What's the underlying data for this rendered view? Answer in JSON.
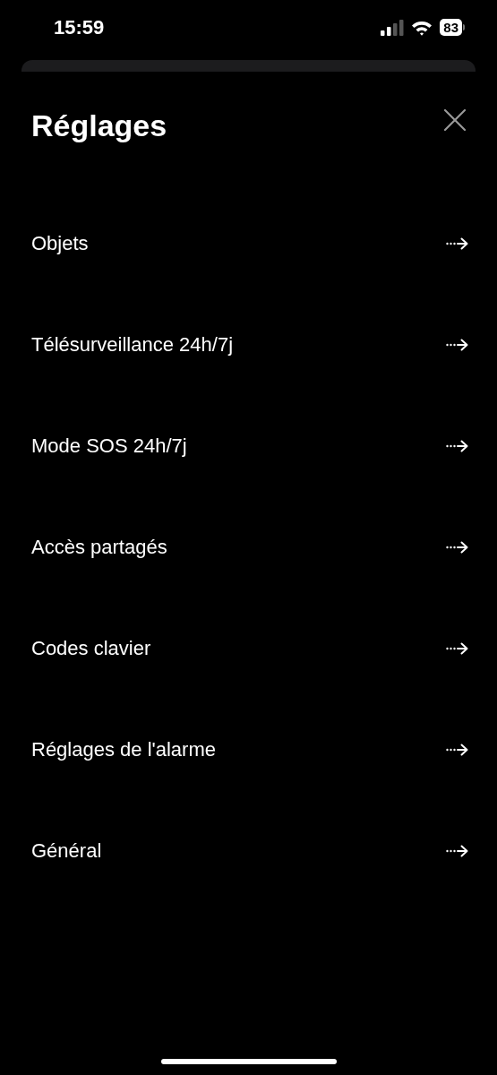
{
  "status_bar": {
    "time": "15:59",
    "battery": "83"
  },
  "sheet": {
    "title": "Réglages"
  },
  "items": [
    {
      "label": "Objets"
    },
    {
      "label": "Télésurveillance 24h/7j"
    },
    {
      "label": "Mode SOS 24h/7j"
    },
    {
      "label": "Accès partagés"
    },
    {
      "label": "Codes clavier"
    },
    {
      "label": "Réglages de l'alarme"
    },
    {
      "label": "Général"
    }
  ]
}
